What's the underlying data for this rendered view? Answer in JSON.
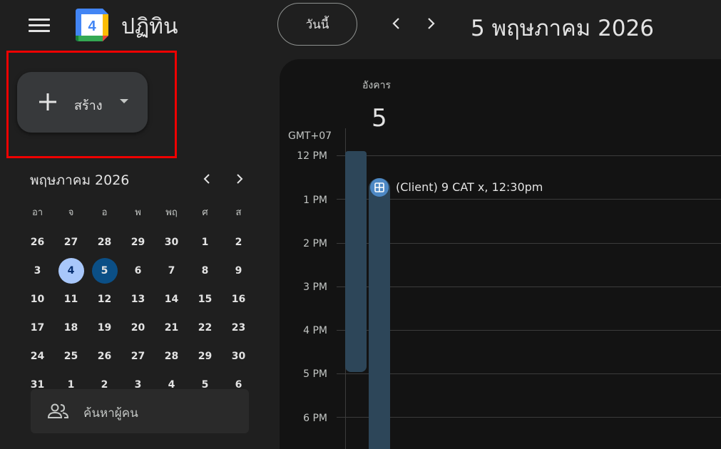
{
  "header": {
    "app_name": "ปฏิทิน",
    "logo_date": "4",
    "today_label": "วันนี้",
    "date_title": "5 พฤษภาคม 2026"
  },
  "create": {
    "label": "สร้าง"
  },
  "mini_calendar": {
    "title": "พฤษภาคม 2026",
    "weekdays": [
      "อา",
      "จ",
      "อ",
      "พ",
      "พฤ",
      "ศ",
      "ส"
    ],
    "weeks": [
      [
        "26",
        "27",
        "28",
        "29",
        "30",
        "1",
        "2"
      ],
      [
        "3",
        "4",
        "5",
        "6",
        "7",
        "8",
        "9"
      ],
      [
        "10",
        "11",
        "12",
        "13",
        "14",
        "15",
        "16"
      ],
      [
        "17",
        "18",
        "19",
        "20",
        "21",
        "22",
        "23"
      ],
      [
        "24",
        "25",
        "26",
        "27",
        "28",
        "29",
        "30"
      ],
      [
        "31",
        "1",
        "2",
        "3",
        "4",
        "5",
        "6"
      ]
    ]
  },
  "people_search": {
    "placeholder": "ค้นหาผู้คน"
  },
  "day_view": {
    "day_name": "อังคาร",
    "day_number": "5",
    "timezone": "GMT+07",
    "times": [
      "12 PM",
      "1 PM",
      "2 PM",
      "3 PM",
      "4 PM",
      "5 PM",
      "6 PM"
    ],
    "event_title": "(Client) 9 CAT x, 12:30pm"
  },
  "colors": {
    "selected_day": "#a8c7fa",
    "today": "#0b4f86",
    "event": "#2d4659",
    "highlight": "#ee0000"
  }
}
